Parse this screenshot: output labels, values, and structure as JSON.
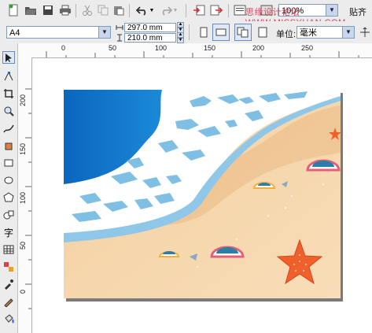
{
  "toolbar_top": {
    "zoom_value": "100%",
    "snap_label": "贴齐",
    "watermark": "思缘设计论坛 WWW.MISSYUAN.COM"
  },
  "property_bar": {
    "paper_size": "A4",
    "width": "297.0 mm",
    "height": "210.0 mm",
    "units_label": "单位:",
    "units_value": "毫米"
  },
  "ruler": {
    "h_ticks": [
      "0",
      "50",
      "100",
      "150",
      "200",
      "250"
    ],
    "v_ticks": [
      "200",
      "150",
      "100",
      "50",
      "0"
    ]
  },
  "icons": {
    "new": "new-document-icon",
    "open": "open-folder-icon",
    "save": "save-icon",
    "print": "print-icon",
    "cut": "cut-icon",
    "copy": "copy-icon",
    "paste": "paste-icon",
    "undo": "undo-icon",
    "redo": "redo-icon",
    "import": "import-icon",
    "export": "export-icon"
  },
  "colors": {
    "sea_deep": "#0a6fc4",
    "sea_light": "#7ec3e8",
    "foam": "#ffffff",
    "sand": "#f3cfa0",
    "sand_dark": "#e7b27a",
    "starfish": "#f0602a"
  }
}
